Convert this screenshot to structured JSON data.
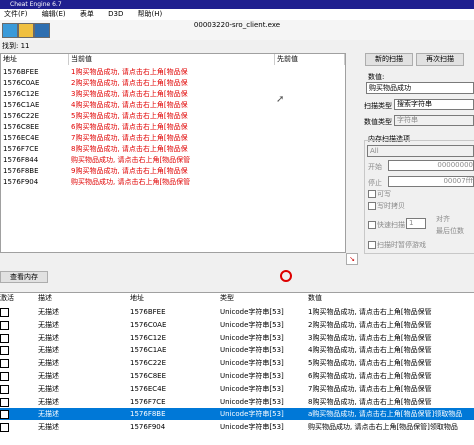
{
  "window": {
    "title": "Cheat Engine 6.7"
  },
  "menu": [
    "文件(F)",
    "编辑(E)",
    "表单",
    "D3D",
    "帮助(H)"
  ],
  "process_title": "00003220-sro_client.exe",
  "found": "找到: 11",
  "results": {
    "col_address": "地址",
    "col_current": "当前值",
    "col_previous": "先前值",
    "rows": [
      {
        "addr": "1576BFEE",
        "val": "1购买物品成功, 请点击右上角[物品保"
      },
      {
        "addr": "1576C0AE",
        "val": "2购买物品成功, 请点击右上角[物品保"
      },
      {
        "addr": "1576C12E",
        "val": "3购买物品成功, 请点击右上角[物品保"
      },
      {
        "addr": "1576C1AE",
        "val": "4购买物品成功, 请点击右上角[物品保"
      },
      {
        "addr": "1576C22E",
        "val": "5购买物品成功, 请点击右上角[物品保"
      },
      {
        "addr": "1576C8EE",
        "val": "6购买物品成功, 请点击右上角[物品保"
      },
      {
        "addr": "1576EC4E",
        "val": "7购买物品成功, 请点击右上角[物品保"
      },
      {
        "addr": "1576F7CE",
        "val": "8购买物品成功, 请点击右上角[物品保"
      },
      {
        "addr": "1576F844",
        "val": "购买物品成功, 请点击右上角[物品保管"
      },
      {
        "addr": "1576F8BE",
        "val": "9购买物品成功, 请点击右上角[物品保"
      },
      {
        "addr": "1576F904",
        "val": "购买物品成功, 请点击右上角[物品保管"
      }
    ]
  },
  "scan": {
    "new_scan": "新的扫描",
    "next_scan": "再次扫描",
    "value_label": "数值:",
    "value": "购买物品成功",
    "scan_type_label": "扫描类型",
    "scan_type": "搜索字符串",
    "value_type_label": "数值类型",
    "value_type": "字符串",
    "memory_options": "内存扫描选项",
    "region": "All",
    "start_label": "开始",
    "start": "00000000",
    "stop_label": "停止",
    "stop": "00007fff",
    "writable": "可写",
    "copy_on_write": "写时拷贝",
    "fast_scan": "快速扫描",
    "fast_value": "1",
    "align": "对齐",
    "last_digits": "最后位数",
    "pause_game": "扫描时暂停游戏"
  },
  "view_memory": "查看内存",
  "table": {
    "headers": [
      "激活",
      "描述",
      "地址",
      "类型",
      "数值"
    ],
    "rows": [
      {
        "desc": "无描述",
        "addr": "1576BFEE",
        "type": "Unicode字符串[53]",
        "val": "1购买物品成功, 请点击右上角[物品保管"
      },
      {
        "desc": "无描述",
        "addr": "1576C0AE",
        "type": "Unicode字符串[53]",
        "val": "2购买物品成功, 请点击右上角[物品保管"
      },
      {
        "desc": "无描述",
        "addr": "1576C12E",
        "type": "Unicode字符串[53]",
        "val": "3购买物品成功, 请点击右上角[物品保管"
      },
      {
        "desc": "无描述",
        "addr": "1576C1AE",
        "type": "Unicode字符串[53]",
        "val": "4购买物品成功, 请点击右上角[物品保管"
      },
      {
        "desc": "无描述",
        "addr": "1576C22E",
        "type": "Unicode字符串[53]",
        "val": "5购买物品成功, 请点击右上角[物品保管"
      },
      {
        "desc": "无描述",
        "addr": "1576C8EE",
        "type": "Unicode字符串[53]",
        "val": "6购买物品成功, 请点击右上角[物品保管"
      },
      {
        "desc": "无描述",
        "addr": "1576EC4E",
        "type": "Unicode字符串[53]",
        "val": "7购买物品成功, 请点击右上角[物品保管"
      },
      {
        "desc": "无描述",
        "addr": "1576F7CE",
        "type": "Unicode字符串[53]",
        "val": "8购买物品成功, 请点击右上角[物品保管"
      },
      {
        "desc": "无描述",
        "addr": "1576F8BE",
        "type": "Unicode字符串[53]",
        "val": "a购买物品成功, 请点击右上角[物品保管]领取物品"
      },
      {
        "desc": "无描述",
        "addr": "1576F904",
        "type": "Unicode字符串[53]",
        "val": "购买物品成功, 请点击右上角[物品保管]领取物品"
      }
    ]
  }
}
